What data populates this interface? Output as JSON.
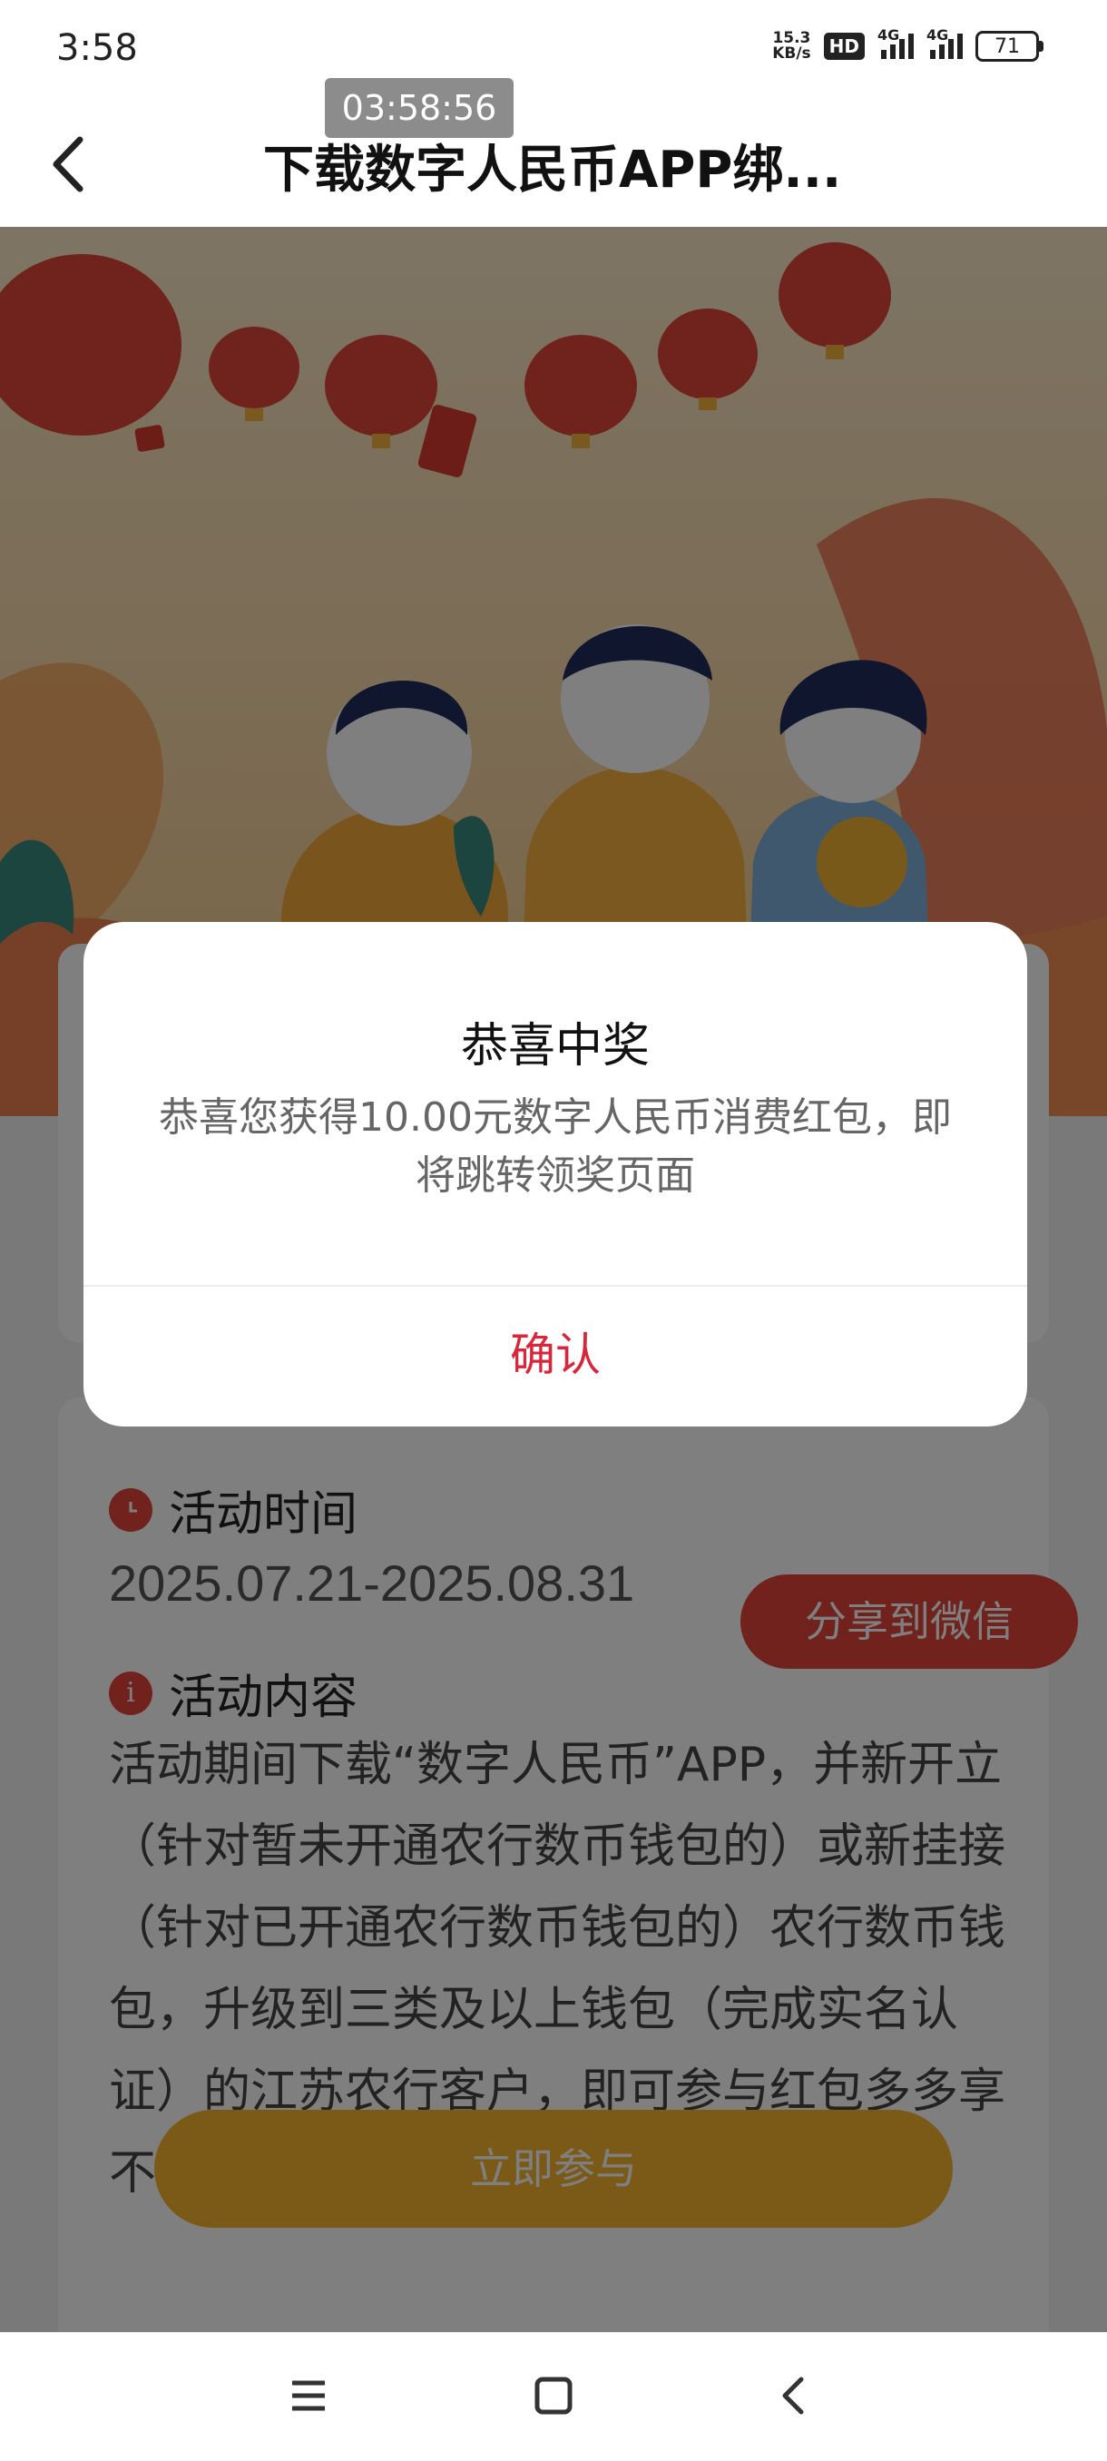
{
  "status_bar": {
    "time": "3:58",
    "net_speed_value": "15.3",
    "net_speed_unit": "KB/s",
    "hd_badge": "HD",
    "signal1_label": "4G",
    "signal2_label": "4G",
    "battery": "71"
  },
  "overlay_time": "03:58:56",
  "header": {
    "title": "下载数字人民币APP绑..."
  },
  "dialog": {
    "title": "恭喜中奖",
    "message": "恭喜您获得10.00元数字人民币消费红包，即将跳转领奖页面",
    "confirm_label": "确认"
  },
  "activity": {
    "time_heading": "活动时间",
    "date_range": "2025.07.21-2025.08.31",
    "share_label": "分享到微信",
    "content_heading": "活动内容",
    "description": "活动期间下载“数字人民币”APP，并新开立（针对暂未开通农行数币钱包的）或新挂接（针对已开通农行数币钱包的）农行数币钱包，升级到三类及以上钱包（完成实名认证）的江苏农行客户，即可参与红包多多享不停-下载数字人民币APP",
    "join_label": "立即参与"
  },
  "colors": {
    "accent_red": "#e4443a",
    "confirm_red": "#d8263a",
    "join_yellow": "#f6b52e"
  },
  "icons": [
    "back-arrow-icon",
    "clock-icon",
    "info-icon",
    "menu-icon",
    "home-icon",
    "nav-back-icon"
  ]
}
